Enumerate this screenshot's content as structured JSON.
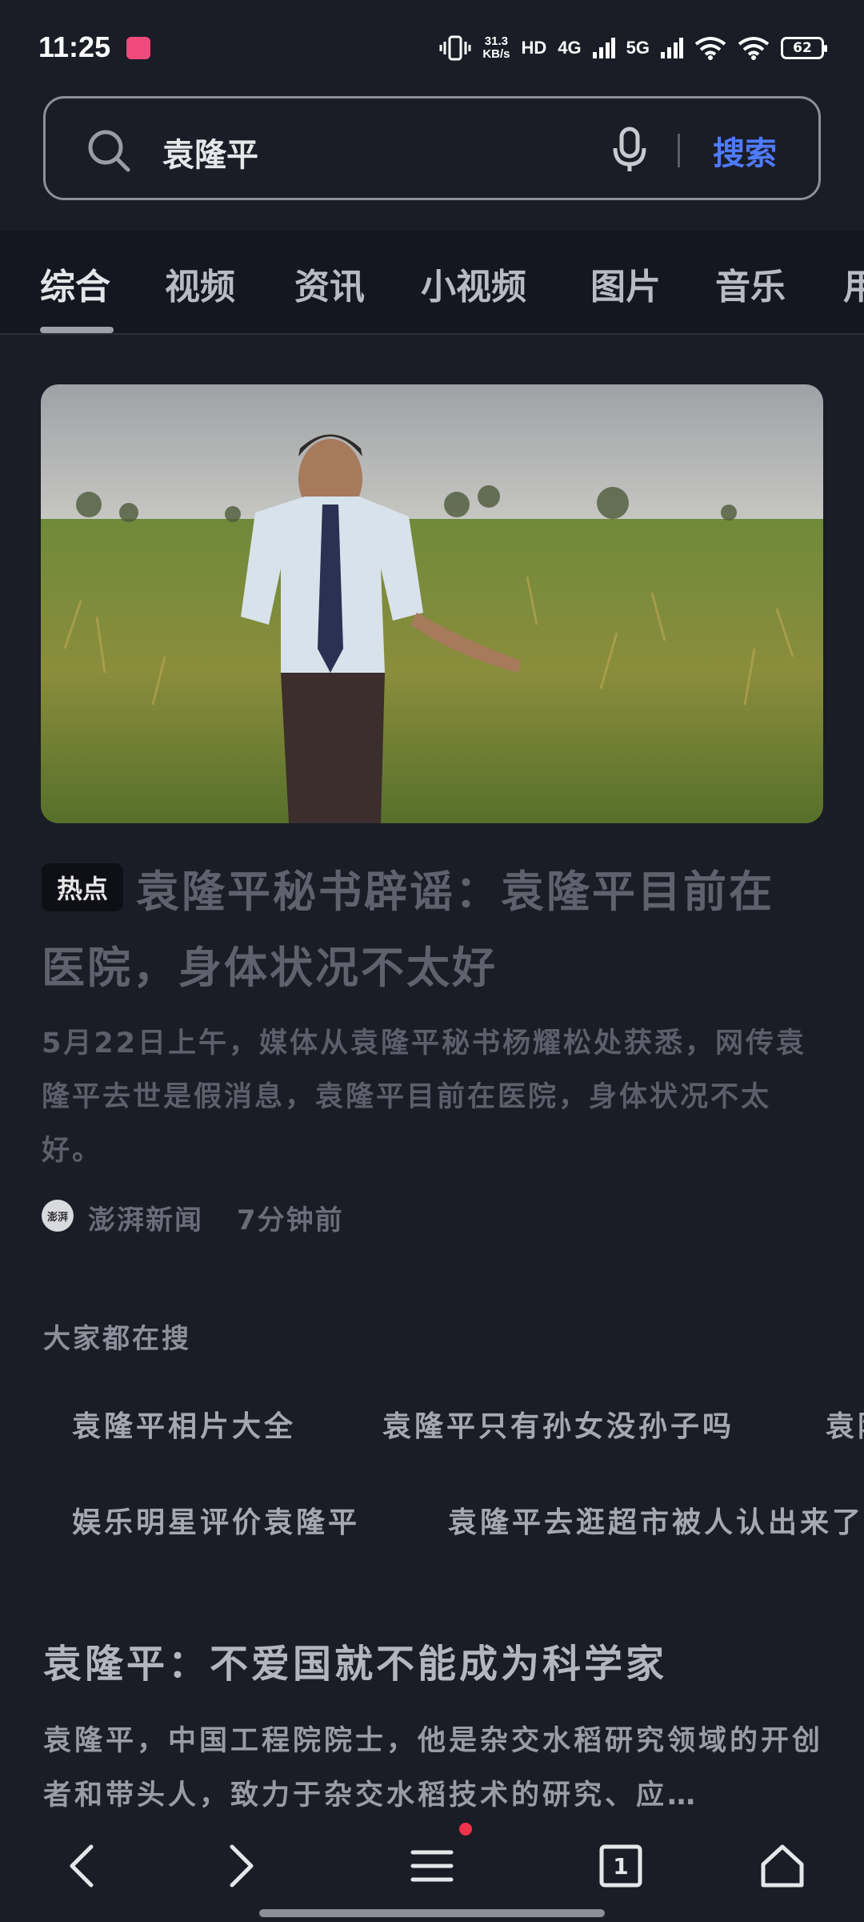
{
  "status_bar": {
    "time": "11:25",
    "network_speed": "31.3",
    "network_speed_unit": "KB/s",
    "hd_label": "HD",
    "sim1_label": "4G",
    "sim2_label": "5G",
    "battery": "62"
  },
  "search": {
    "query": "袁隆平",
    "submit_label": "搜索"
  },
  "tabs": [
    {
      "label": "综合",
      "active": true
    },
    {
      "label": "视频"
    },
    {
      "label": "资讯"
    },
    {
      "label": "小视频"
    },
    {
      "label": "图片"
    },
    {
      "label": "音乐"
    },
    {
      "label": "用"
    }
  ],
  "article": {
    "badge": "热点",
    "title": "袁隆平秘书辟谣：袁隆平目前在医院，身体状况不太好",
    "summary": "5月22日上午，媒体从袁隆平秘书杨耀松处获悉，网传袁隆平去世是假消息，袁隆平目前在医院，身体状况不太好。",
    "source_logo": "澎湃",
    "source": "澎湃新闻",
    "time": "7分钟前"
  },
  "related": {
    "heading": "大家都在搜",
    "items": [
      "袁隆平相片大全",
      "袁隆平只有孙女没孙子吗",
      "袁隆",
      "娱乐明星评价袁隆平",
      "袁隆平去逛超市被人认出来了"
    ]
  },
  "article2": {
    "title": "袁隆平：不爱国就不能成为科学家",
    "summary": "袁隆平，中国工程院院士，他是杂交水稻研究领域的开创者和带头人，致力于杂交水稻技术的研究、应…"
  },
  "bottom_nav": {
    "tab_count": "1"
  },
  "colors": {
    "background": "#1a1c26",
    "accent": "#4f7bff",
    "notification_dot": "#f0324a"
  }
}
